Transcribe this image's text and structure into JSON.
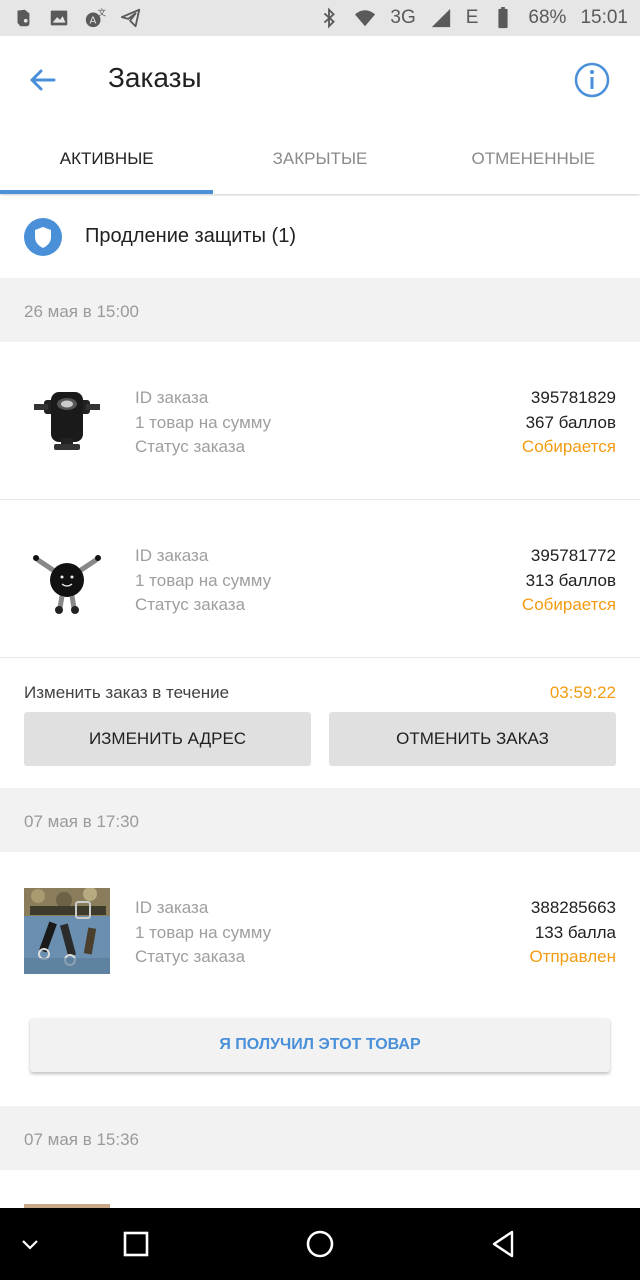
{
  "status_bar": {
    "network": "3G",
    "signal_letter": "E",
    "battery": "68%",
    "time": "15:01",
    "left_icons": [
      "evernote-icon",
      "image-icon",
      "translate-icon",
      "telegram-icon"
    ],
    "right_icons": [
      "bluetooth-icon",
      "wifi-icon",
      "signal-icon",
      "battery-icon"
    ]
  },
  "app_bar": {
    "title": "Заказы"
  },
  "tabs": [
    {
      "label": "АКТИВНЫЕ",
      "active": true
    },
    {
      "label": "ЗАКРЫТЫЕ",
      "active": false
    },
    {
      "label": "ОТМЕНЕННЫЕ",
      "active": false
    }
  ],
  "protection": {
    "label": "Продление защиты (1)"
  },
  "labels": {
    "id": "ID заказа",
    "items": "1 товар на сумму",
    "status": "Статус заказа"
  },
  "groups": [
    {
      "date": "26 мая в 15:00",
      "orders": [
        {
          "id": "395781829",
          "sum": "367 баллов",
          "status": "Собирается",
          "thumb": "phone-holder-image"
        },
        {
          "id": "395781772",
          "sum": "313 баллов",
          "status": "Собирается",
          "thumb": "gravity-holder-image"
        }
      ],
      "change": {
        "label": "Изменить заказ в течение",
        "timer": "03:59:22",
        "change_address": "ИЗМЕНИТЬ АДРЕС",
        "cancel_order": "ОТМЕНИТЬ ЗАКАЗ"
      }
    },
    {
      "date": "07 мая в 17:30",
      "orders": [
        {
          "id": "388285663",
          "sum": "133 балла",
          "status": "Отправлен",
          "thumb": "belt-clips-image"
        }
      ],
      "received": "Я ПОЛУЧИЛ ЭТОТ ТОВАР"
    },
    {
      "date": "07 мая в 15:36"
    }
  ],
  "colors": {
    "accent": "#4a90d9",
    "status_orange": "#f39c12",
    "band_grey": "#f2f2f2"
  }
}
